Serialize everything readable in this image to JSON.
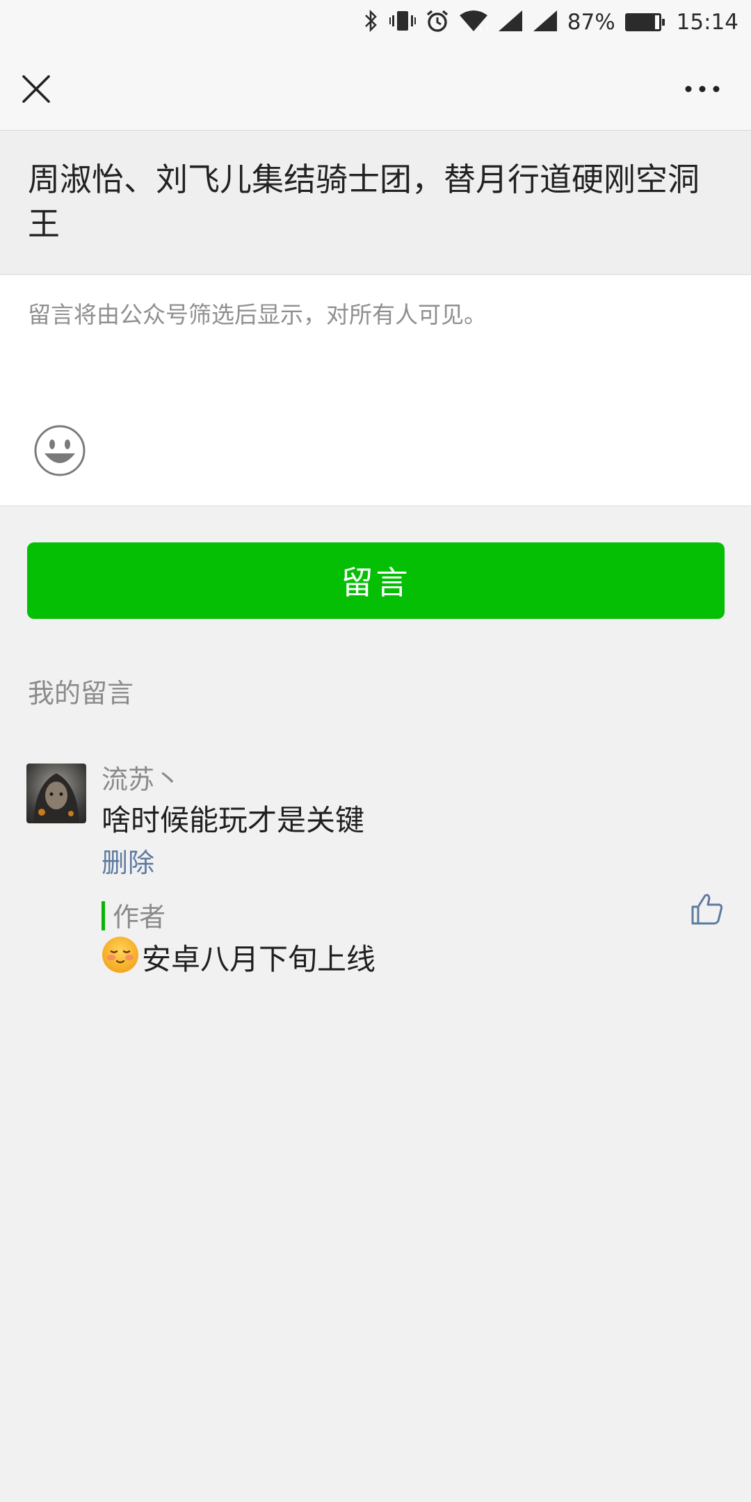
{
  "status_bar": {
    "battery_percent": "87%",
    "battery_level": 0.87,
    "time": "15:14",
    "icons": [
      "bluetooth-icon",
      "vibrate-icon",
      "alarm-icon",
      "wifi-icon",
      "signal-icon",
      "signal-icon",
      "battery-icon"
    ]
  },
  "nav": {
    "close_icon": "close-icon",
    "more_icon": "more-icon"
  },
  "article": {
    "title": "周淑怡、刘飞儿集结骑士团，替月行道硬刚空洞王"
  },
  "comment_input": {
    "placeholder": "留言将由公众号筛选后显示，对所有人可见。",
    "value": "",
    "emoji_icon": "smiley-icon"
  },
  "submit_button": {
    "label": "留言",
    "color": "#05bf05"
  },
  "my_comments": {
    "section_label": "我的留言",
    "items": [
      {
        "nickname": "流苏丶",
        "text": "啥时候能玩才是关键",
        "delete_label": "删除",
        "reply": {
          "label": "作者",
          "emoji_icon": "blush-emoji-icon",
          "text": "安卓八月下旬上线"
        },
        "like_icon": "thumbs-up-icon"
      }
    ]
  },
  "colors": {
    "accent_green": "#05bf05",
    "link_blue": "#5e7a9f",
    "reply_bar": "#07b507"
  }
}
